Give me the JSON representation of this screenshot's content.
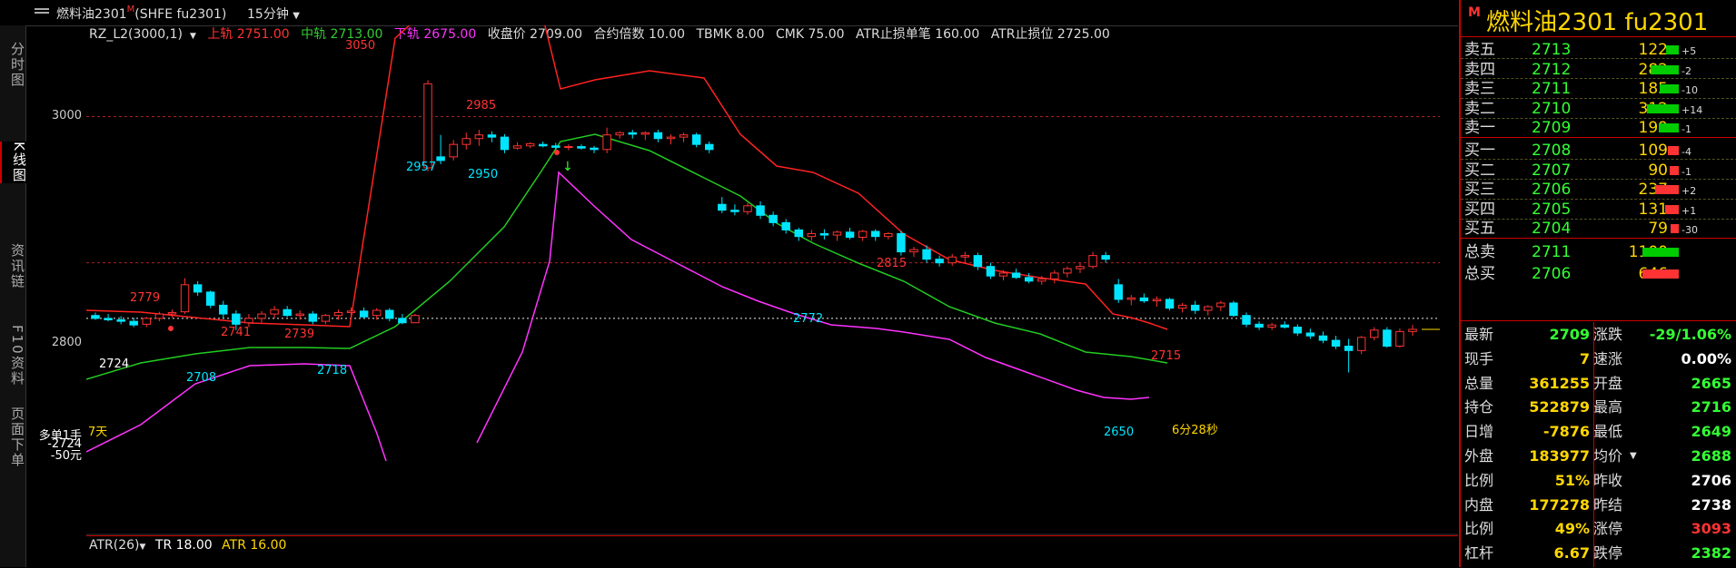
{
  "window": {
    "title": "燃料油2301",
    "title_marker": "M",
    "title_code": "(SHFE fu2301)",
    "period": "15分钟"
  },
  "left_tabs": [
    {
      "label": "分时图",
      "active": false
    },
    {
      "label": "K线图",
      "active": true
    },
    {
      "label": "资讯链",
      "active": false
    },
    {
      "label": "F10资料",
      "active": false
    },
    {
      "label": "页面下单",
      "active": false
    }
  ],
  "indicator": {
    "name": "RZ_L2(3000,1)",
    "upper": "上轨 2751.00",
    "mid": "中轨 2713.00",
    "lower": "下轨 2675.00",
    "close": "收盘价 2709.00",
    "mult": "合约倍数 10.00",
    "tbmk": "TBMK 8.00",
    "cmk": "CMK 75.00",
    "atr_stop_bill": "ATR止损单笔 160.00",
    "atr_stop_pos": "ATR止损位 2725.00"
  },
  "y_labels": {
    "p3000": "3000",
    "p2800": "2800",
    "pos": "多单1手",
    "pos_price": "-2724",
    "pnl": "-50元"
  },
  "annotations": {
    "a3050": "3050",
    "a2985": "2985",
    "a2957": "2957",
    "a2950": "2950",
    "a2779": "2779",
    "a2741": "2741",
    "a2739": "2739",
    "a2708": "2708",
    "a2718": "2718",
    "a2815": "2815",
    "a2772": "2772",
    "a2715": "2715",
    "a2650": "2650",
    "a2724": "2724",
    "days": "7天",
    "countdown": "6分28秒"
  },
  "atr": {
    "name": "ATR(26)",
    "tr": "TR 18.00",
    "atr": "ATR 16.00"
  },
  "panel": {
    "marker": "M",
    "name": "燃料油2301  fu2301",
    "sell": [
      {
        "label": "卖五",
        "price": "2713",
        "vol": "122",
        "chg": "+5"
      },
      {
        "label": "卖四",
        "price": "2712",
        "vol": "282",
        "chg": "-2"
      },
      {
        "label": "卖三",
        "price": "2711",
        "vol": "185",
        "chg": "-10"
      },
      {
        "label": "卖二",
        "price": "2710",
        "vol": "312",
        "chg": "+14"
      },
      {
        "label": "卖一",
        "price": "2709",
        "vol": "199",
        "chg": "-1"
      }
    ],
    "buy": [
      {
        "label": "买一",
        "price": "2708",
        "vol": "109",
        "chg": "-4"
      },
      {
        "label": "买二",
        "price": "2707",
        "vol": "90",
        "chg": "-1"
      },
      {
        "label": "买三",
        "price": "2706",
        "vol": "237",
        "chg": "+2"
      },
      {
        "label": "买四",
        "price": "2705",
        "vol": "131",
        "chg": "+1"
      },
      {
        "label": "买五",
        "price": "2704",
        "vol": "79",
        "chg": "-30"
      }
    ],
    "total": [
      {
        "label": "总卖",
        "price": "2711",
        "vol": "1100"
      },
      {
        "label": "总买",
        "price": "2706",
        "vol": "646"
      }
    ],
    "stats": [
      {
        "l1": "最新",
        "v1": "2709",
        "c1": "#33ff33",
        "l2": "涨跌",
        "v2": "-29/1.06%",
        "c2": "#33ff33"
      },
      {
        "l1": "现手",
        "v1": "7",
        "c1": "#ffd700",
        "l2": "速涨",
        "v2": "0.00%",
        "c2": "#ffffff"
      },
      {
        "l1": "总量",
        "v1": "361255",
        "c1": "#ffd700",
        "l2": "开盘",
        "v2": "2665",
        "c2": "#33ff33"
      },
      {
        "l1": "持仓",
        "v1": "522879",
        "c1": "#ffd700",
        "l2": "最高",
        "v2": "2716",
        "c2": "#33ff33"
      },
      {
        "l1": "日增",
        "v1": "-7876",
        "c1": "#ffd700",
        "l2": "最低",
        "v2": "2649",
        "c2": "#33ff33"
      },
      {
        "l1": "外盘",
        "v1": "183977",
        "c1": "#ffd700",
        "l2": "均价",
        "v2": "2688",
        "c2": "#33ff33"
      },
      {
        "l1": "比例",
        "v1": "51%",
        "c1": "#ffd700",
        "l2": "昨收",
        "v2": "2706",
        "c2": "#ffffff"
      },
      {
        "l1": "内盘",
        "v1": "177278",
        "c1": "#ffd700",
        "l2": "昨结",
        "v2": "2738",
        "c2": "#ffffff"
      },
      {
        "l1": "比例",
        "v1": "49%",
        "c1": "#ffd700",
        "l2": "涨停",
        "v2": "3093",
        "c2": "#ff3333"
      },
      {
        "l1": "杠杆",
        "v1": "6.67",
        "c1": "#ffd700",
        "l2": "跌停",
        "v2": "2382",
        "c2": "#33ff33"
      }
    ]
  },
  "colors": {
    "up": "#ff3333",
    "down": "#00e5ff",
    "upper": "#ff2222",
    "mid": "#22cc22",
    "lower": "#ff33ff",
    "text": "#ffd700"
  },
  "chart_data": {
    "type": "candlestick",
    "ohlc": [
      [
        2728,
        2732,
        2722,
        2724
      ],
      [
        2724,
        2730,
        2720,
        2722
      ],
      [
        2722,
        2727,
        2716,
        2720
      ],
      [
        2720,
        2725,
        2712,
        2715
      ],
      [
        2716,
        2726,
        2712,
        2724
      ],
      [
        2724,
        2733,
        2720,
        2730
      ],
      [
        2730,
        2736,
        2725,
        2732
      ],
      [
        2733,
        2779,
        2730,
        2770
      ],
      [
        2770,
        2775,
        2755,
        2760
      ],
      [
        2760,
        2762,
        2738,
        2742
      ],
      [
        2742,
        2748,
        2725,
        2730
      ],
      [
        2730,
        2735,
        2708,
        2716
      ],
      [
        2718,
        2730,
        2712,
        2724
      ],
      [
        2724,
        2734,
        2718,
        2730
      ],
      [
        2730,
        2741,
        2724,
        2736
      ],
      [
        2736,
        2741,
        2726,
        2728
      ],
      [
        2728,
        2735,
        2722,
        2730
      ],
      [
        2730,
        2734,
        2716,
        2720
      ],
      [
        2720,
        2730,
        2716,
        2728
      ],
      [
        2728,
        2736,
        2722,
        2732
      ],
      [
        2732,
        2739,
        2726,
        2734
      ],
      [
        2734,
        2739,
        2724,
        2726
      ],
      [
        2728,
        2738,
        2722,
        2735
      ],
      [
        2735,
        2738,
        2720,
        2724
      ],
      [
        2724,
        2730,
        2716,
        2718
      ],
      [
        2718,
        2730,
        2718,
        2728
      ],
      [
        2930,
        3050,
        2925,
        3045
      ],
      [
        2945,
        2975,
        2935,
        2940
      ],
      [
        2945,
        2968,
        2940,
        2962
      ],
      [
        2962,
        2978,
        2955,
        2970
      ],
      [
        2970,
        2982,
        2960,
        2975
      ],
      [
        2975,
        2980,
        2965,
        2972
      ],
      [
        2972,
        2976,
        2950,
        2955
      ],
      [
        2957,
        2965,
        2955,
        2960
      ],
      [
        2960,
        2965,
        2957,
        2963
      ],
      [
        2962,
        2966,
        2958,
        2960
      ],
      [
        2960,
        2964,
        2955,
        2958
      ],
      [
        2958,
        2962,
        2954,
        2959
      ],
      [
        2959,
        2962,
        2955,
        2957
      ],
      [
        2957,
        2960,
        2950,
        2955
      ],
      [
        2955,
        2985,
        2950,
        2975
      ],
      [
        2975,
        2980,
        2970,
        2978
      ],
      [
        2978,
        2982,
        2970,
        2976
      ],
      [
        2976,
        2980,
        2968,
        2978
      ],
      [
        2978,
        2982,
        2965,
        2970
      ],
      [
        2970,
        2976,
        2962,
        2972
      ],
      [
        2972,
        2978,
        2965,
        2975
      ],
      [
        2975,
        2978,
        2958,
        2962
      ],
      [
        2962,
        2966,
        2950,
        2955
      ],
      [
        2880,
        2890,
        2868,
        2872
      ],
      [
        2872,
        2880,
        2865,
        2870
      ],
      [
        2870,
        2882,
        2866,
        2878
      ],
      [
        2878,
        2884,
        2860,
        2865
      ],
      [
        2865,
        2870,
        2850,
        2855
      ],
      [
        2855,
        2860,
        2840,
        2845
      ],
      [
        2845,
        2848,
        2830,
        2836
      ],
      [
        2836,
        2845,
        2830,
        2840
      ],
      [
        2840,
        2846,
        2832,
        2838
      ],
      [
        2838,
        2844,
        2830,
        2842
      ],
      [
        2842,
        2848,
        2832,
        2835
      ],
      [
        2835,
        2845,
        2830,
        2843
      ],
      [
        2843,
        2846,
        2830,
        2836
      ],
      [
        2836,
        2842,
        2832,
        2840
      ],
      [
        2840,
        2844,
        2810,
        2815
      ],
      [
        2815,
        2822,
        2808,
        2818
      ],
      [
        2818,
        2824,
        2800,
        2805
      ],
      [
        2805,
        2810,
        2795,
        2800
      ],
      [
        2800,
        2812,
        2796,
        2808
      ],
      [
        2808,
        2815,
        2800,
        2810
      ],
      [
        2810,
        2814,
        2790,
        2795
      ],
      [
        2795,
        2800,
        2778,
        2782
      ],
      [
        2782,
        2790,
        2776,
        2786
      ],
      [
        2786,
        2792,
        2778,
        2780
      ],
      [
        2780,
        2786,
        2772,
        2775
      ],
      [
        2775,
        2782,
        2770,
        2778
      ],
      [
        2778,
        2790,
        2772,
        2786
      ],
      [
        2786,
        2795,
        2780,
        2792
      ],
      [
        2792,
        2800,
        2786,
        2795
      ],
      [
        2795,
        2815,
        2792,
        2810
      ],
      [
        2810,
        2815,
        2800,
        2805
      ],
      [
        2770,
        2778,
        2745,
        2750
      ],
      [
        2750,
        2756,
        2742,
        2752
      ],
      [
        2752,
        2758,
        2745,
        2748
      ],
      [
        2748,
        2754,
        2740,
        2750
      ],
      [
        2750,
        2752,
        2735,
        2738
      ],
      [
        2738,
        2745,
        2732,
        2742
      ],
      [
        2742,
        2748,
        2730,
        2735
      ],
      [
        2735,
        2742,
        2728,
        2740
      ],
      [
        2740,
        2748,
        2734,
        2745
      ],
      [
        2745,
        2748,
        2726,
        2728
      ],
      [
        2728,
        2732,
        2712,
        2716
      ],
      [
        2716,
        2720,
        2708,
        2712
      ],
      [
        2712,
        2718,
        2708,
        2715
      ],
      [
        2715,
        2720,
        2710,
        2712
      ],
      [
        2712,
        2716,
        2700,
        2704
      ],
      [
        2704,
        2710,
        2696,
        2700
      ],
      [
        2700,
        2706,
        2690,
        2694
      ],
      [
        2694,
        2700,
        2682,
        2686
      ],
      [
        2686,
        2696,
        2650,
        2680
      ],
      [
        2680,
        2700,
        2675,
        2698
      ],
      [
        2698,
        2712,
        2694,
        2708
      ],
      [
        2708,
        2712,
        2684,
        2686
      ],
      [
        2686,
        2710,
        2684,
        2706
      ],
      [
        2706,
        2715,
        2700,
        2709
      ]
    ],
    "upper_band": [
      2740,
      2740,
      2738,
      2736,
      2735,
      2736,
      2734,
      2733,
      2733,
      2732,
      2731,
      2730,
      2730,
      2731,
      2730,
      2730,
      2729,
      2730,
      2730,
      2730,
      2730,
      2730,
      2730,
      2730,
      2730,
      2730
    ],
    "ylim": [
      2560,
      3100
    ]
  }
}
